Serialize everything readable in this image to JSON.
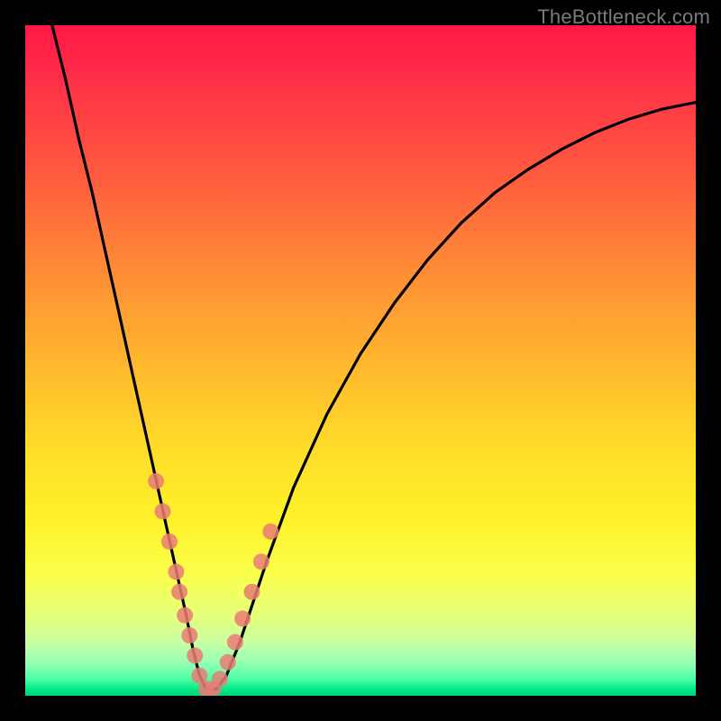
{
  "watermark": "TheBottleneck.com",
  "chart_data": {
    "type": "line",
    "title": "",
    "xlabel": "",
    "ylabel": "",
    "xlim": [
      0,
      100
    ],
    "ylim": [
      0,
      100
    ],
    "notes": "V-shaped bottleneck curve on a rainbow gradient; minimum touches the green band near x≈27. Axes and tick labels are not rendered in the source image, so x/y are in percentage-of-plot coordinates. Salmon dot markers cluster on both branches near the trough.",
    "series": [
      {
        "name": "bottleneck-curve",
        "x": [
          4.0,
          6.0,
          8.0,
          10.0,
          12.0,
          14.0,
          16.0,
          18.0,
          20.0,
          22.0,
          24.0,
          25.0,
          26.0,
          27.0,
          28.5,
          30.0,
          32.0,
          34.0,
          36.0,
          40.0,
          45.0,
          50.0,
          55.0,
          60.0,
          65.0,
          70.0,
          75.0,
          80.0,
          85.0,
          90.0,
          95.0,
          100.0
        ],
        "y": [
          100.0,
          92.0,
          83.0,
          75.0,
          66.0,
          57.0,
          48.0,
          39.0,
          30.0,
          21.0,
          12.0,
          7.0,
          3.0,
          1.0,
          1.0,
          3.0,
          8.0,
          14.0,
          20.0,
          31.0,
          42.0,
          51.0,
          58.5,
          65.0,
          70.5,
          75.0,
          78.5,
          81.5,
          84.0,
          86.0,
          87.5,
          88.5
        ]
      },
      {
        "name": "markers",
        "x": [
          19.5,
          20.5,
          21.5,
          22.5,
          23.0,
          23.8,
          24.5,
          25.3,
          26.0,
          27.0,
          28.0,
          29.0,
          30.2,
          31.3,
          32.4,
          33.8,
          35.2,
          36.6
        ],
        "y": [
          32.0,
          27.5,
          23.0,
          18.5,
          15.5,
          12.0,
          9.0,
          6.0,
          3.0,
          1.0,
          1.0,
          2.5,
          5.0,
          8.0,
          11.5,
          15.5,
          20.0,
          24.5
        ]
      }
    ],
    "colors": {
      "curve": "#000000",
      "markers": "#e97c74",
      "gradient_top": "#ff1846",
      "gradient_bottom": "#00d477",
      "frame": "#000000"
    }
  }
}
